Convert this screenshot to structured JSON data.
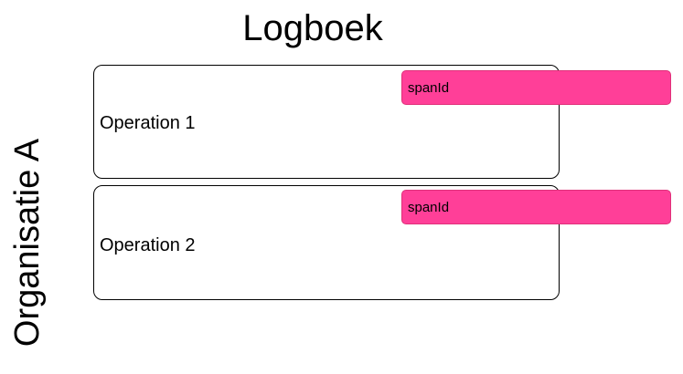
{
  "title": "Logboek",
  "organisation": "Organisatie A",
  "operations": [
    {
      "label": "Operation 1",
      "span_label": "spanId"
    },
    {
      "label": "Operation 2",
      "span_label": "spanId"
    }
  ],
  "colors": {
    "span_fill": "#ff3f98",
    "span_border": "#e0307a",
    "box_border": "#000000",
    "background": "#ffffff"
  }
}
